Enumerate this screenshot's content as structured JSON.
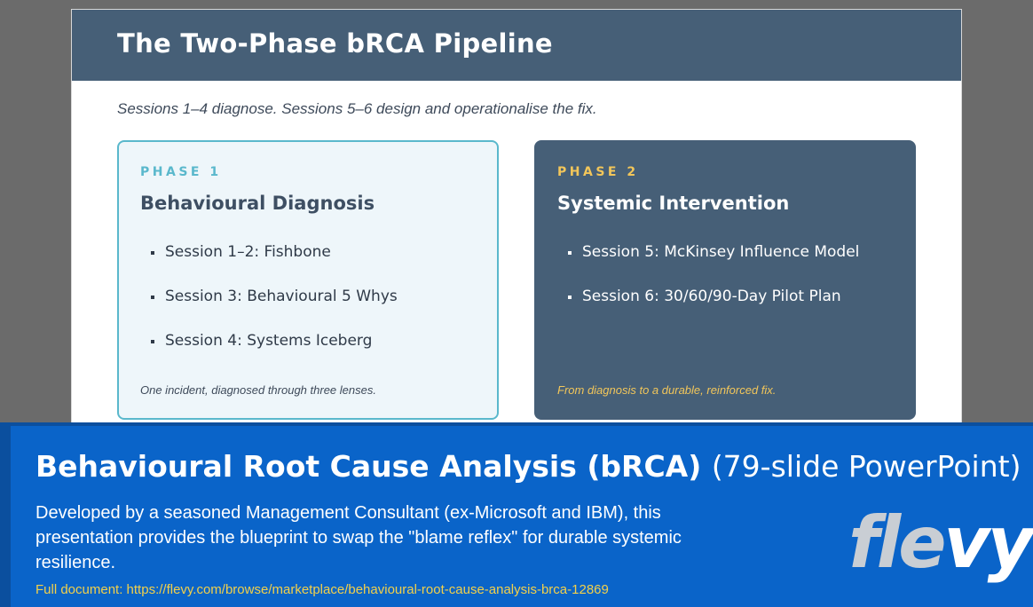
{
  "slide": {
    "title": "The Two-Phase bRCA Pipeline",
    "subtitle": "Sessions 1–4 diagnose. Sessions 5–6 design and operationalise the fix.",
    "phases": [
      {
        "label": "PHASE 1",
        "title": "Behavioural Diagnosis",
        "items": [
          "Session 1–2: Fishbone",
          "Session 3: Behavioural 5 Whys",
          "Session 4: Systems Iceberg"
        ],
        "footer": "One incident, diagnosed through three lenses."
      },
      {
        "label": "PHASE 2",
        "title": "Systemic Intervention",
        "items": [
          "Session 5: McKinsey Influence Model",
          "Session 6: 30/60/90-Day Pilot Plan"
        ],
        "footer": "From diagnosis to a durable, reinforced fix."
      }
    ]
  },
  "banner": {
    "title_bold": "Behavioural Root Cause Analysis (bRCA)",
    "title_rest": "(79-slide PowerPoint)",
    "description": "Developed by a seasoned Management Consultant (ex-Microsoft and IBM), this presentation provides the blueprint to swap the \"blame reflex\" for durable systemic resilience.",
    "link": "Full document: https://flevy.com/browse/marketplace/behavioural-root-cause-analysis-brca-12869",
    "logo_part1": "fle",
    "logo_part2": "vy"
  },
  "colors": {
    "header": "#465f77",
    "phase1_accent": "#5ab8cc",
    "phase2_accent": "#f2c65a",
    "banner": "#0a64c9",
    "link": "#f2d04a"
  }
}
